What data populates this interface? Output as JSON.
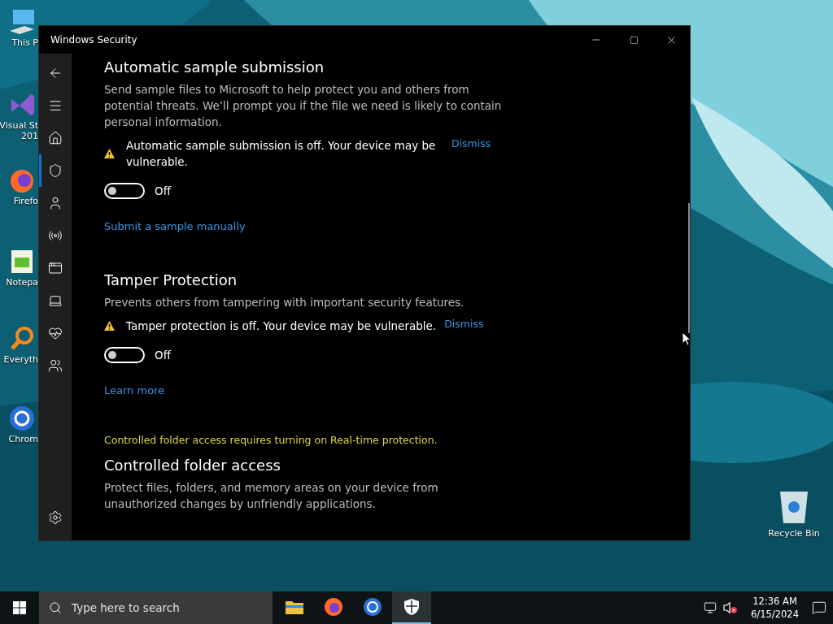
{
  "desktop_icons": [
    {
      "kind": "computer",
      "label": "This P"
    },
    {
      "kind": "studio",
      "label": "Visual St\n201"
    },
    {
      "kind": "firefox",
      "label": "Firefo"
    },
    {
      "kind": "notepad",
      "label": "Notepa"
    },
    {
      "kind": "search",
      "label": "Everyth"
    },
    {
      "kind": "chrome",
      "label": "Chrom"
    }
  ],
  "recycle_bin": {
    "label": "Recycle Bin"
  },
  "window": {
    "title": "Windows Security"
  },
  "sidebar": {
    "items": [
      {
        "kind": "back",
        "selected": false
      },
      {
        "kind": "menu",
        "selected": false
      },
      {
        "kind": "home",
        "selected": false
      },
      {
        "kind": "shield",
        "selected": true
      },
      {
        "kind": "account",
        "selected": false
      },
      {
        "kind": "network",
        "selected": false
      },
      {
        "kind": "app",
        "selected": false
      },
      {
        "kind": "device",
        "selected": false
      },
      {
        "kind": "health",
        "selected": false
      },
      {
        "kind": "family",
        "selected": false
      }
    ],
    "settings": {
      "kind": "settings"
    }
  },
  "sections": [
    {
      "kind": "setting",
      "title": "Automatic sample submission",
      "description": "Send sample files to Microsoft to help protect you and others from potential threats. We’ll prompt you if the file we need is likely to contain personal information.",
      "warning": {
        "text": "Automatic sample submission is off. Your device may be vulnerable.",
        "action": "Dismiss"
      },
      "toggle": {
        "on": false,
        "label": "Off"
      },
      "link": "Submit a sample manually"
    },
    {
      "kind": "setting",
      "title": "Tamper Protection",
      "description": "Prevents others from tampering with important security features.",
      "warning": {
        "text": "Tamper protection is off. Your device may be vulnerable.",
        "action": "Dismiss"
      },
      "toggle": {
        "on": false,
        "label": "Off"
      },
      "link": "Learn more"
    },
    {
      "kind": "notice",
      "text": "Controlled folder access requires turning on Real-time protection."
    },
    {
      "kind": "setting",
      "title": "Controlled folder access",
      "description": "Protect files, folders, and memory areas on your device from unauthorized changes by unfriendly applications."
    }
  ],
  "taskbar": {
    "search": {
      "placeholder": "Type here to search"
    },
    "apps": [
      {
        "kind": "folder",
        "selected": false
      },
      {
        "kind": "firefox",
        "selected": false
      },
      {
        "kind": "chrome",
        "selected": false
      },
      {
        "kind": "shield",
        "selected": true
      }
    ],
    "time": "12:36 AM",
    "date": "6/15/2024"
  }
}
